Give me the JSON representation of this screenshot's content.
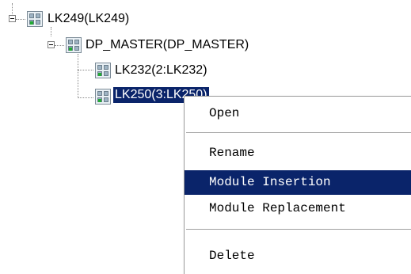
{
  "tree": {
    "root": {
      "label": "LK249(LK249)"
    },
    "master": {
      "label": "DP_MASTER(DP_MASTER)"
    },
    "children": [
      {
        "label": "LK232(2:LK232)",
        "selected": false
      },
      {
        "label": "LK250(3:LK250)",
        "selected": true,
        "visible_label": "LK250(3:LK250)"
      }
    ],
    "icon": "module-device-icon",
    "expander_icon": "collapse-minus-icon"
  },
  "context_menu": {
    "items": [
      {
        "label": "Open"
      },
      {
        "label": "Rename"
      },
      {
        "label": "Module Insertion",
        "highlighted": true
      },
      {
        "label": "Module Replacement"
      },
      {
        "label": "Delete"
      }
    ]
  },
  "colors": {
    "selection": "#0a246a",
    "selection_text": "#ffffff",
    "led": "#22aa33"
  }
}
